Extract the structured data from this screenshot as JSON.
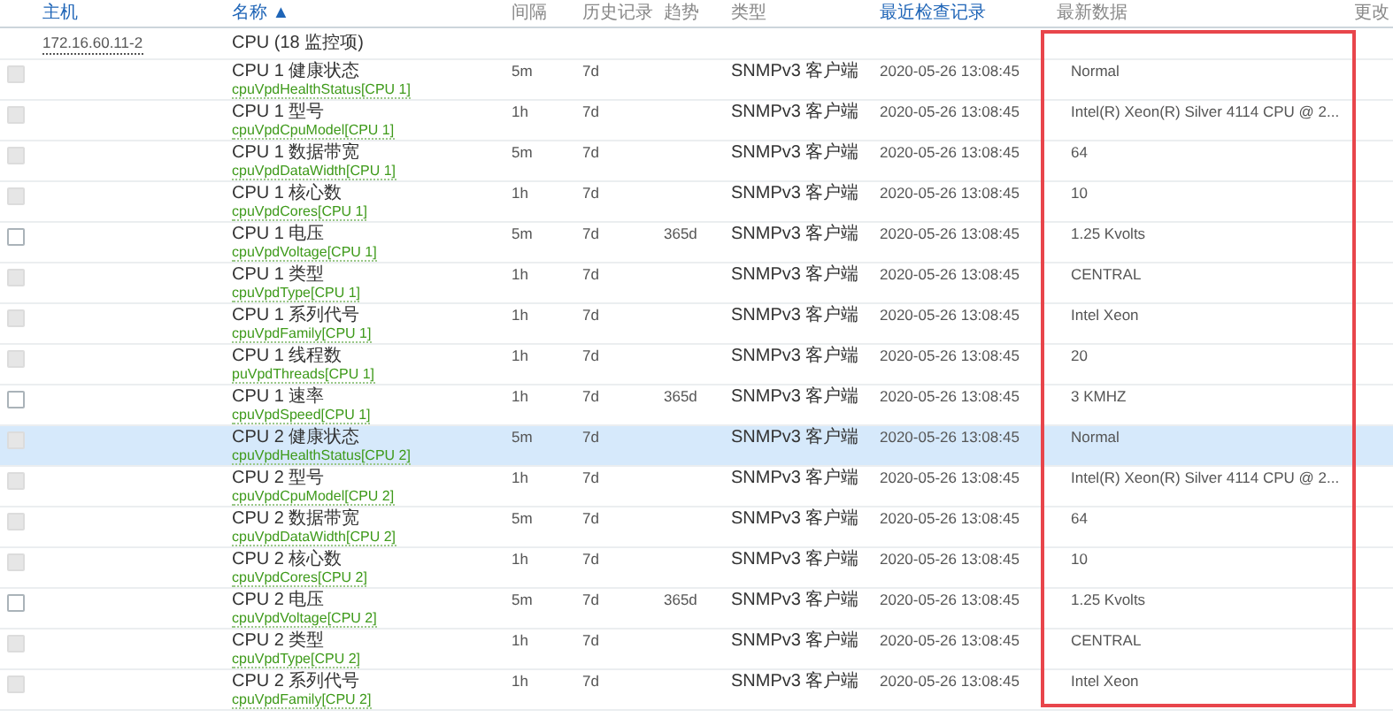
{
  "columns": [
    {
      "label": "主机",
      "sortable": true
    },
    {
      "label": "名称 ▲",
      "sortable": true
    },
    {
      "label": "间隔",
      "sortable": false
    },
    {
      "label": "历史记录",
      "sortable": false
    },
    {
      "label": "趋势",
      "sortable": false
    },
    {
      "label": "类型",
      "sortable": false
    },
    {
      "label": "最近检查记录",
      "sortable": true
    },
    {
      "label": "最新数据",
      "sortable": false
    },
    {
      "label": "更改",
      "sortable": false
    }
  ],
  "group": {
    "host": "172.16.60.11-2",
    "name": "CPU (18 监控项)"
  },
  "rows": [
    {
      "disabled": true,
      "selected": false,
      "name": "CPU 1 健康状态",
      "key": "cpuVpdHealthStatus[CPU 1]",
      "interval": "5m",
      "history": "7d",
      "type": "SNMPv3 客户端",
      "last_check": "2020-05-26 13:08:45",
      "latest": "Normal"
    },
    {
      "disabled": true,
      "selected": false,
      "name": "CPU 1 型号",
      "key": "cpuVpdCpuModel[CPU 1]",
      "interval": "1h",
      "history": "7d",
      "type": "SNMPv3 客户端",
      "last_check": "2020-05-26 13:08:45",
      "latest": "Intel(R) Xeon(R) Silver 4114 CPU @ 2..."
    },
    {
      "disabled": true,
      "selected": false,
      "name": "CPU 1 数据带宽",
      "key": "cpuVpdDataWidth[CPU 1]",
      "interval": "5m",
      "history": "7d",
      "type": "SNMPv3 客户端",
      "last_check": "2020-05-26 13:08:45",
      "latest": "64"
    },
    {
      "disabled": true,
      "selected": false,
      "name": "CPU 1 核心数",
      "key": "cpuVpdCores[CPU 1]",
      "interval": "1h",
      "history": "7d",
      "type": "SNMPv3 客户端",
      "last_check": "2020-05-26 13:08:45",
      "latest": "10"
    },
    {
      "disabled": false,
      "selected": false,
      "name": "CPU 1 电压",
      "key": "cpuVpdVoltage[CPU 1]",
      "interval": "5m",
      "history": "7d",
      "trends": "365d",
      "type": "SNMPv3 客户端",
      "last_check": "2020-05-26 13:08:45",
      "latest": "1.25 Kvolts"
    },
    {
      "disabled": true,
      "selected": false,
      "name": "CPU 1 类型",
      "key": "cpuVpdType[CPU 1]",
      "interval": "1h",
      "history": "7d",
      "type": "SNMPv3 客户端",
      "last_check": "2020-05-26 13:08:45",
      "latest": "CENTRAL"
    },
    {
      "disabled": true,
      "selected": false,
      "name": "CPU 1 系列代号",
      "key": "cpuVpdFamily[CPU 1]",
      "interval": "1h",
      "history": "7d",
      "type": "SNMPv3 客户端",
      "last_check": "2020-05-26 13:08:45",
      "latest": "Intel Xeon"
    },
    {
      "disabled": true,
      "selected": false,
      "name": "CPU 1 线程数",
      "key": "puVpdThreads[CPU 1]",
      "interval": "1h",
      "history": "7d",
      "type": "SNMPv3 客户端",
      "last_check": "2020-05-26 13:08:45",
      "latest": "20"
    },
    {
      "disabled": false,
      "selected": false,
      "name": "CPU 1 速率",
      "key": "cpuVpdSpeed[CPU 1]",
      "interval": "1h",
      "history": "7d",
      "trends": "365d",
      "type": "SNMPv3 客户端",
      "last_check": "2020-05-26 13:08:45",
      "latest": "3 KMHZ"
    },
    {
      "disabled": true,
      "selected": true,
      "name": "CPU 2 健康状态",
      "key": "cpuVpdHealthStatus[CPU 2]",
      "interval": "5m",
      "history": "7d",
      "type": "SNMPv3 客户端",
      "last_check": "2020-05-26 13:08:45",
      "latest": "Normal"
    },
    {
      "disabled": true,
      "selected": false,
      "name": "CPU 2 型号",
      "key": "cpuVpdCpuModel[CPU 2]",
      "interval": "1h",
      "history": "7d",
      "type": "SNMPv3 客户端",
      "last_check": "2020-05-26 13:08:45",
      "latest": "Intel(R) Xeon(R) Silver 4114 CPU @ 2..."
    },
    {
      "disabled": true,
      "selected": false,
      "name": "CPU 2 数据带宽",
      "key": "cpuVpdDataWidth[CPU 2]",
      "interval": "5m",
      "history": "7d",
      "type": "SNMPv3 客户端",
      "last_check": "2020-05-26 13:08:45",
      "latest": "64"
    },
    {
      "disabled": true,
      "selected": false,
      "name": "CPU 2 核心数",
      "key": "cpuVpdCores[CPU 2]",
      "interval": "1h",
      "history": "7d",
      "type": "SNMPv3 客户端",
      "last_check": "2020-05-26 13:08:45",
      "latest": "10"
    },
    {
      "disabled": false,
      "selected": false,
      "name": "CPU 2 电压",
      "key": "cpuVpdVoltage[CPU 2]",
      "interval": "5m",
      "history": "7d",
      "trends": "365d",
      "type": "SNMPv3 客户端",
      "last_check": "2020-05-26 13:08:45",
      "latest": "1.25 Kvolts"
    },
    {
      "disabled": true,
      "selected": false,
      "name": "CPU 2 类型",
      "key": "cpuVpdType[CPU 2]",
      "interval": "1h",
      "history": "7d",
      "type": "SNMPv3 客户端",
      "last_check": "2020-05-26 13:08:45",
      "latest": "CENTRAL"
    },
    {
      "disabled": true,
      "selected": false,
      "name": "CPU 2 系列代号",
      "key": "cpuVpdFamily[CPU 2]",
      "interval": "1h",
      "history": "7d",
      "type": "SNMPv3 客户端",
      "last_check": "2020-05-26 13:08:45",
      "latest": "Intel Xeon"
    }
  ]
}
